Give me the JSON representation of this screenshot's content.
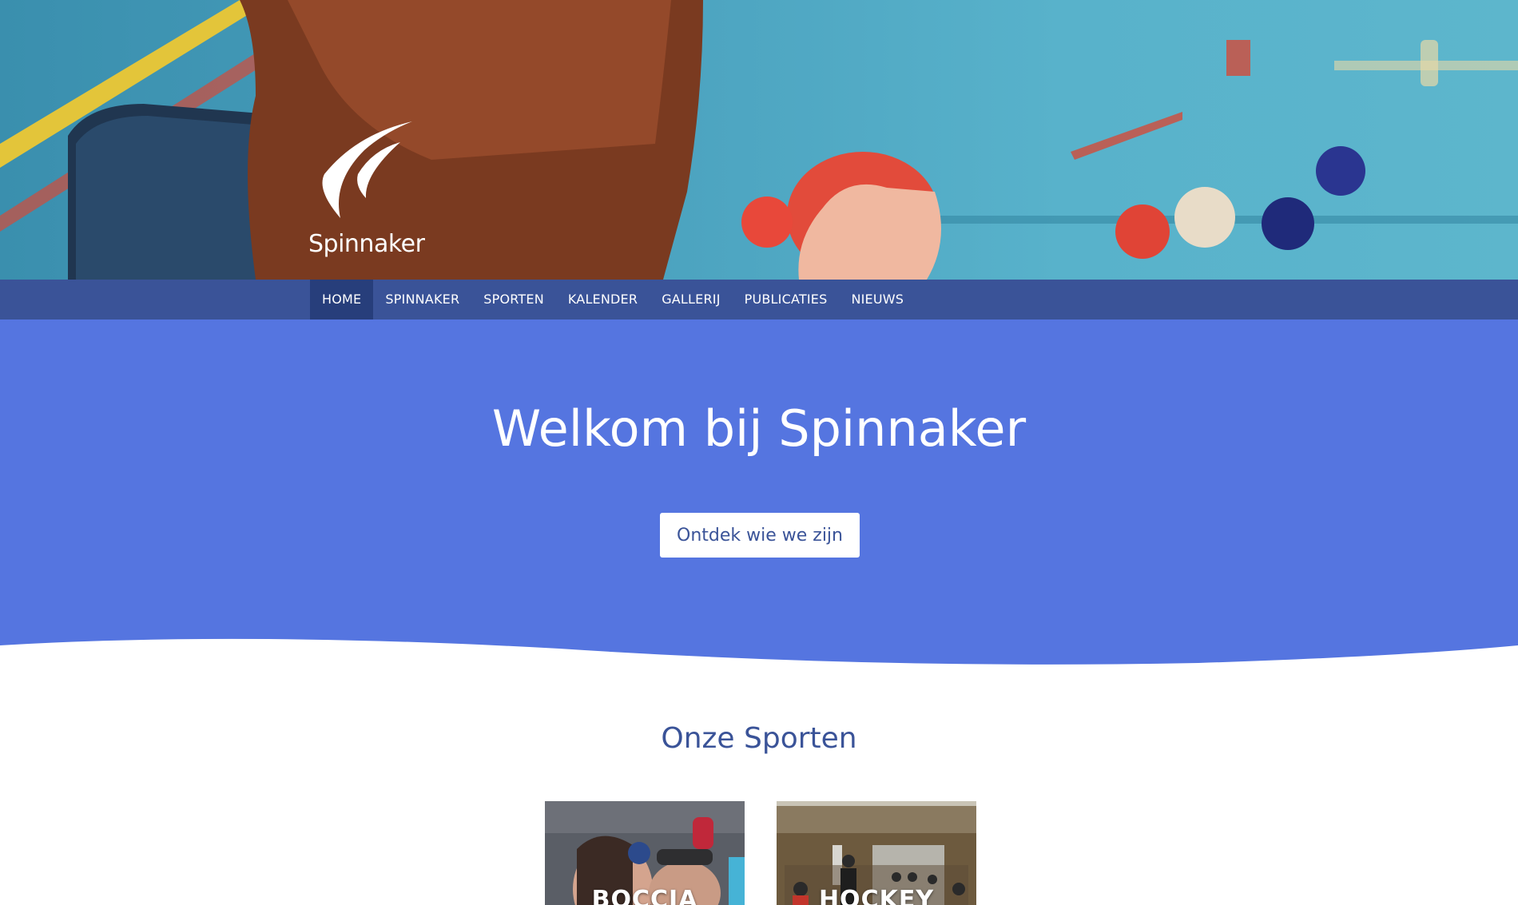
{
  "brand": {
    "name": "Spinnaker"
  },
  "nav": {
    "items": [
      {
        "label": "HOME",
        "active": true
      },
      {
        "label": "SPINNAKER"
      },
      {
        "label": "SPORTEN"
      },
      {
        "label": "KALENDER"
      },
      {
        "label": "GALLERIJ"
      },
      {
        "label": "PUBLICATIES"
      },
      {
        "label": "NIEUWS"
      }
    ]
  },
  "welcome": {
    "title": "Welkom bij Spinnaker",
    "button_label": "Ontdek wie we zijn"
  },
  "sports": {
    "title": "Onze Sporten",
    "cards": [
      {
        "label": "BOCCIA"
      },
      {
        "label": "HOCKEY"
      }
    ]
  },
  "colors": {
    "nav": "#3a5398",
    "nav_active": "#273e7b",
    "accent": "#5575e0",
    "heading": "#3a5398"
  }
}
